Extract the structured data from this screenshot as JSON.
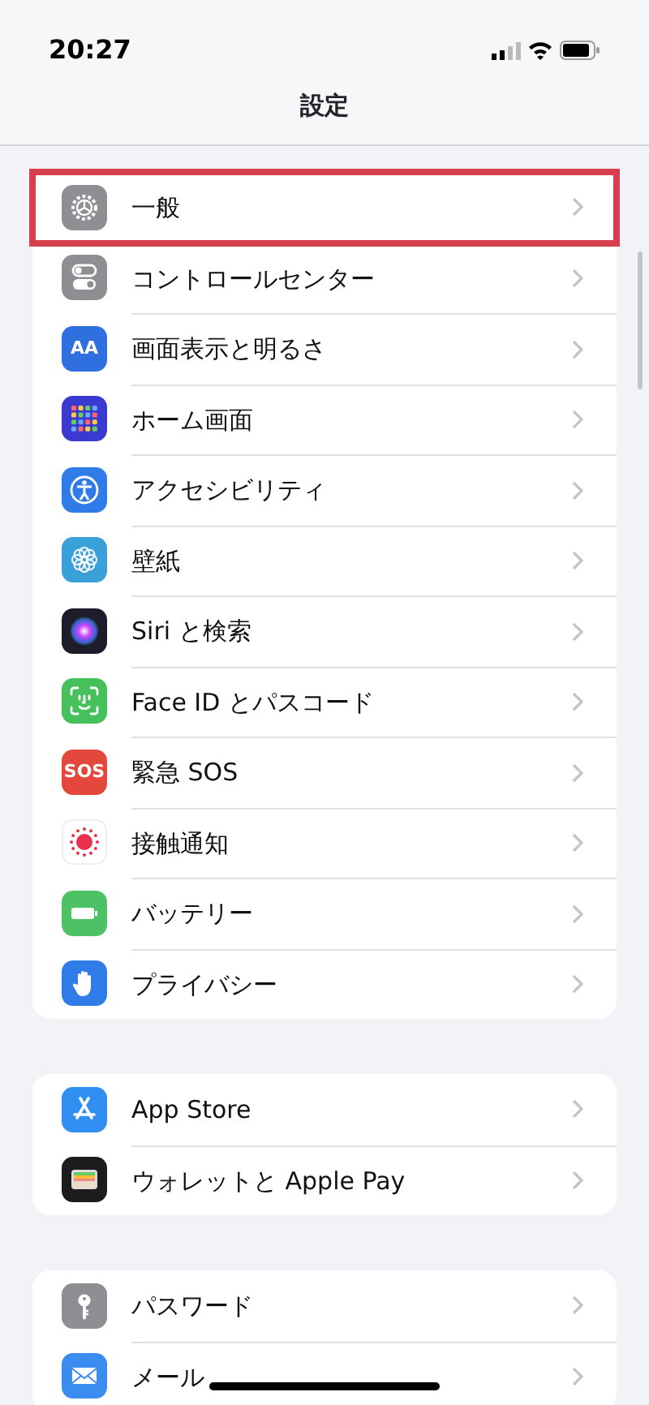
{
  "status_bar": {
    "time": "20:27"
  },
  "title": "設定",
  "groups": [
    {
      "items": [
        {
          "label": "一般",
          "kind": "gear",
          "color": "#8e8e93",
          "highlighted": true
        },
        {
          "label": "コントロールセンター",
          "kind": "toggles",
          "color": "#8e8e93",
          "highlighted": false
        },
        {
          "label": "画面表示と明るさ",
          "kind": "text",
          "icon_text": "AA",
          "color": "#2f6fe0",
          "highlighted": false
        },
        {
          "label": "ホーム画面",
          "kind": "grid",
          "color": "#3a3ad0",
          "highlighted": false
        },
        {
          "label": "アクセシビリティ",
          "kind": "person",
          "color": "#2f7be8",
          "highlighted": false
        },
        {
          "label": "壁紙",
          "kind": "flower",
          "color": "#3aa0d8",
          "highlighted": false
        },
        {
          "label": "Siri と検索",
          "kind": "orb",
          "color": "#1c1c2a",
          "highlighted": false
        },
        {
          "label": "Face ID とパスコード",
          "kind": "face",
          "color": "#45c05a",
          "highlighted": false
        },
        {
          "label": "緊急 SOS",
          "kind": "text",
          "icon_text": "SOS",
          "color": "#e4483c",
          "highlighted": false
        },
        {
          "label": "接触通知",
          "kind": "dots",
          "color": "#ffffff",
          "highlighted": false
        },
        {
          "label": "バッテリー",
          "kind": "battery",
          "color": "#4cc264",
          "highlighted": false
        },
        {
          "label": "プライバシー",
          "kind": "hand",
          "color": "#2f7be8",
          "highlighted": false
        }
      ]
    },
    {
      "items": [
        {
          "label": "App Store",
          "kind": "appstore",
          "color": "#2f8ef0",
          "highlighted": false
        },
        {
          "label": "ウォレットと Apple Pay",
          "kind": "wallet",
          "color": "#1c1c1e",
          "highlighted": false
        }
      ]
    },
    {
      "items": [
        {
          "label": "パスワード",
          "kind": "key",
          "color": "#8e8e93",
          "highlighted": false
        },
        {
          "label": "メール",
          "kind": "mail",
          "color": "#3b8cf0",
          "highlighted": false
        }
      ]
    }
  ]
}
